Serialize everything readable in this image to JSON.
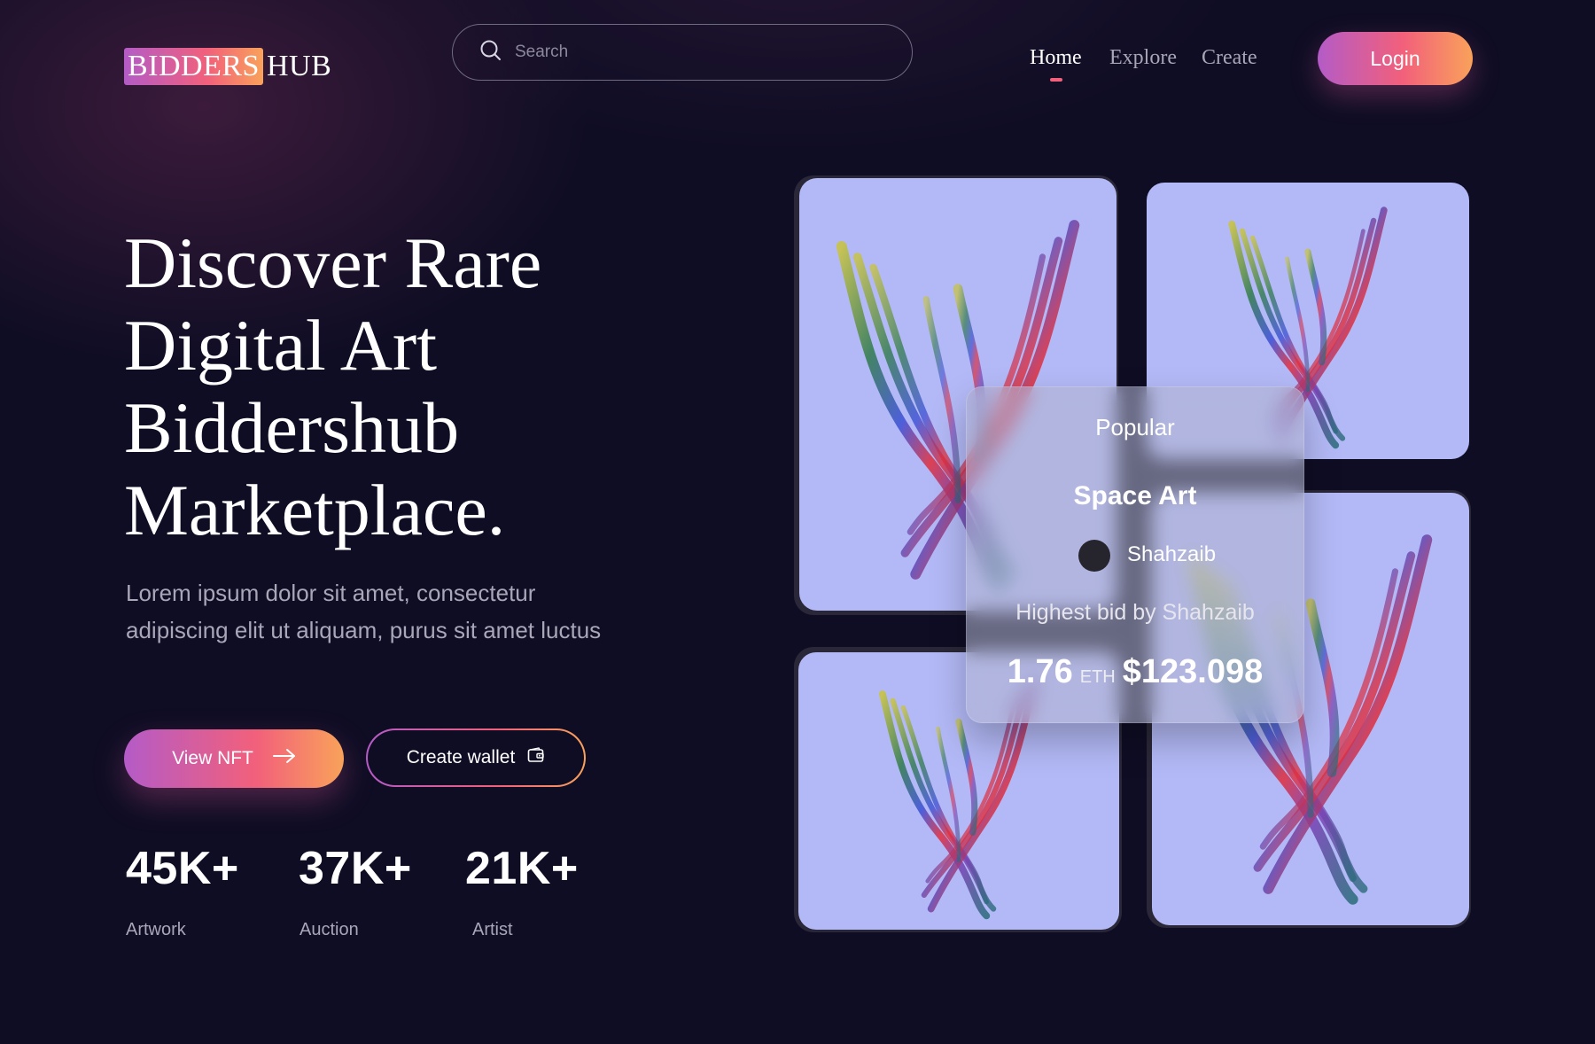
{
  "brand": {
    "logo_highlight": "BIDDERS",
    "logo_rest": "HUB"
  },
  "search": {
    "placeholder": "Search"
  },
  "nav": {
    "items": [
      {
        "label": "Home"
      },
      {
        "label": "Explore"
      },
      {
        "label": "Create"
      }
    ],
    "active": "Home"
  },
  "header": {
    "login_label": "Login"
  },
  "hero": {
    "headline_lines": [
      "Discover Rare",
      "Digital Art",
      "Biddershub",
      "Marketplace."
    ],
    "subtext_lines": [
      "Lorem ipsum dolor sit amet, consectetur",
      "adipiscing elit ut aliquam, purus sit amet luctus"
    ],
    "primary_button": "View NFT",
    "secondary_button": "Create wallet"
  },
  "stats": [
    {
      "value": "45K+",
      "label": "Artwork"
    },
    {
      "value": "37K+",
      "label": "Auction"
    },
    {
      "value": "21K+",
      "label": "Artist"
    }
  ],
  "featured": {
    "tag": "Popular",
    "title": "Space Art",
    "author": "Shahzaib",
    "bid_label": "Highest bid by Shahzaib",
    "price_eth": "1.76",
    "price_unit": "ETH",
    "price_usd": "$123.098"
  },
  "colors": {
    "background": "#0f0d24",
    "accent_start": "#b45bc7",
    "accent_mid": "#f2607b",
    "accent_end": "#f9a25a",
    "card_bg": "#b3b9f6"
  },
  "icons": {
    "search": "search-icon",
    "arrow": "arrow-right-icon",
    "wallet": "wallet-icon"
  }
}
